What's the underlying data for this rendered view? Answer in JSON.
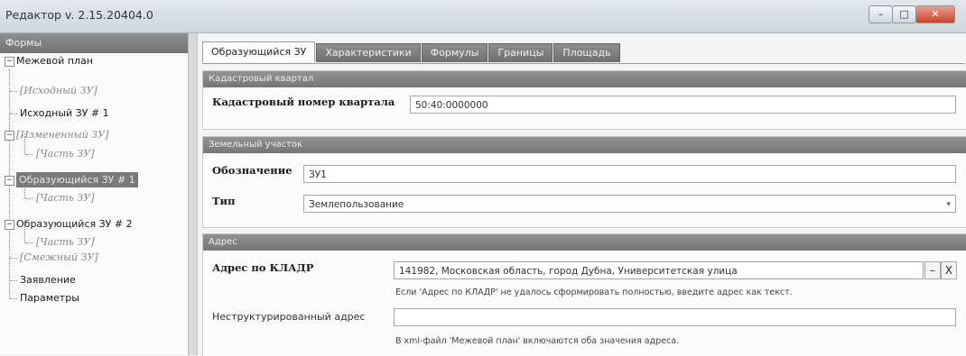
{
  "window": {
    "title": "Редактор v. 2.15.20404.0",
    "buttons": {
      "minimize": "–",
      "maximize": "□",
      "close": "✕"
    }
  },
  "left_panel": {
    "header": "Формы",
    "tree": [
      {
        "label": "Межевой план",
        "expander": "−"
      },
      {
        "label": "[Исходный ЗУ]"
      },
      {
        "label": "Исходный ЗУ # 1"
      },
      {
        "label": "[Измененный ЗУ]",
        "expander": "−"
      },
      {
        "label": "[Часть ЗУ]"
      },
      {
        "label": "Образующийся ЗУ # 1",
        "expander": "−"
      },
      {
        "label": "[Часть ЗУ]"
      },
      {
        "label": "Образующийся ЗУ # 2",
        "expander": "−"
      },
      {
        "label": "[Часть ЗУ]"
      },
      {
        "label": "[Смежный ЗУ]"
      },
      {
        "label": "Заявление"
      },
      {
        "label": "Параметры"
      }
    ]
  },
  "tabs": [
    {
      "label": "Образующийся ЗУ"
    },
    {
      "label": "Характеристики"
    },
    {
      "label": "Формулы"
    },
    {
      "label": "Границы"
    },
    {
      "label": "Площадь"
    }
  ],
  "sections": {
    "kvartal": {
      "header": "Кадастровый квартал",
      "label": "Кадастровый номер квартала",
      "value": "50:40:0000000"
    },
    "uchastok": {
      "header": "Земельный участок",
      "designation_label": "Обозначение",
      "designation_value": "ЗУ1",
      "type_label": "Тип",
      "type_value": "Землепользование",
      "dropdown_icon": "chevron-down-icon"
    },
    "address": {
      "header": "Адрес",
      "kladr_label": "Адрес по КЛАДР",
      "kladr_value": "141982, Московская область, город Дубна, Университетская улица",
      "kladr_btn_menu": "–",
      "kladr_btn_clear": "X",
      "hint1": "Если 'Адрес по КЛАДР' не удалось сформировать полностью, введите адрес как текст.",
      "unstructured_label": "Неструктурированный адрес",
      "unstructured_value": "",
      "hint2": "В xml-файл 'Межевой план' включаются оба значения адреса."
    }
  }
}
